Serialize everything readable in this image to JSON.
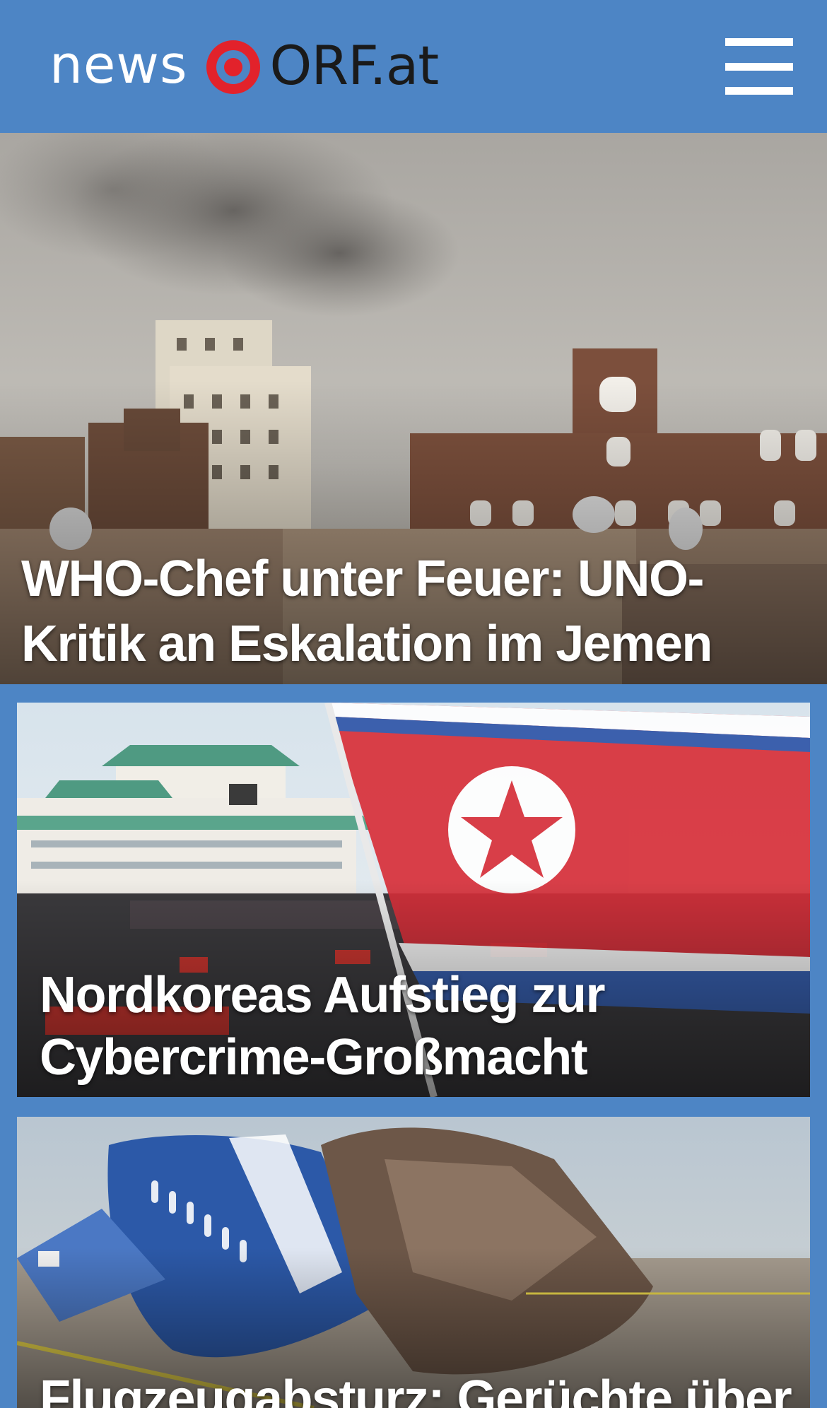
{
  "header": {
    "logo_news": "news",
    "logo_orf": "ORF.at",
    "menu_icon": "hamburger-menu-icon",
    "background_color": "#4d85c5",
    "accent_color": "#e2222b"
  },
  "stories": [
    {
      "title": "WHO-Chef unter Feuer: UNO-Kritik an Eskalation im Jemen",
      "image": "smoke-over-sanaa-buildings"
    },
    {
      "title": "Nordkoreas Aufstieg zur Cybercrime-Großmacht",
      "image": "north-korean-flag-rally"
    },
    {
      "title": "Flugzeugabsturz: Gerüchte über",
      "image": "crashed-airplane-wreckage"
    }
  ]
}
